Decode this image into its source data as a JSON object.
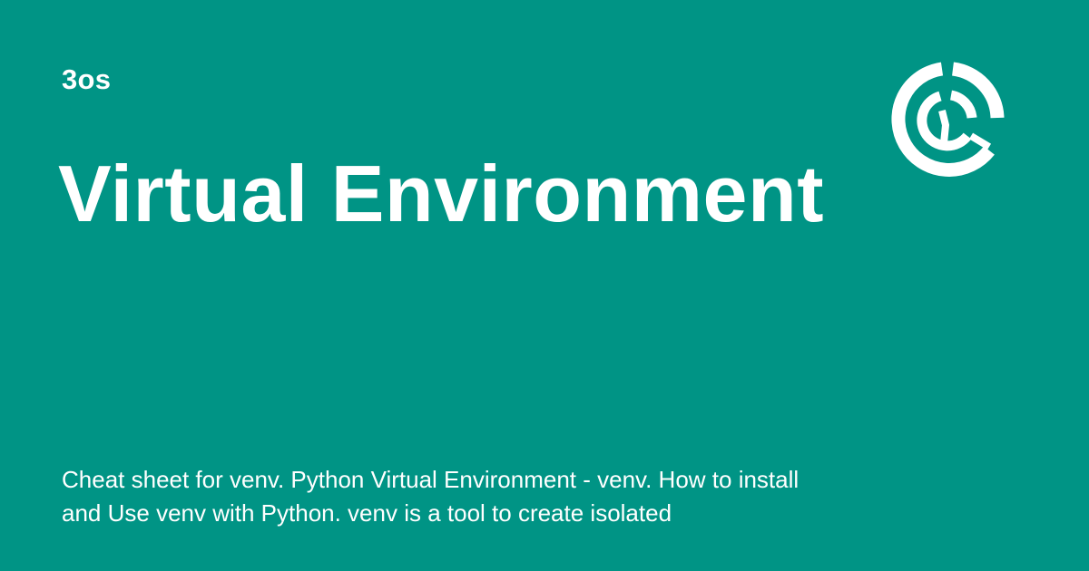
{
  "theme": {
    "background": "#009485",
    "foreground": "#ffffff"
  },
  "card": {
    "site_name": "3os",
    "title": "Virtual Environment",
    "description": "Cheat sheet for venv. Python Virtual Environment - venv. How to install and Use venv with Python. venv is a tool to create isolated",
    "logo_icon": "3os-circle-logo-icon"
  }
}
